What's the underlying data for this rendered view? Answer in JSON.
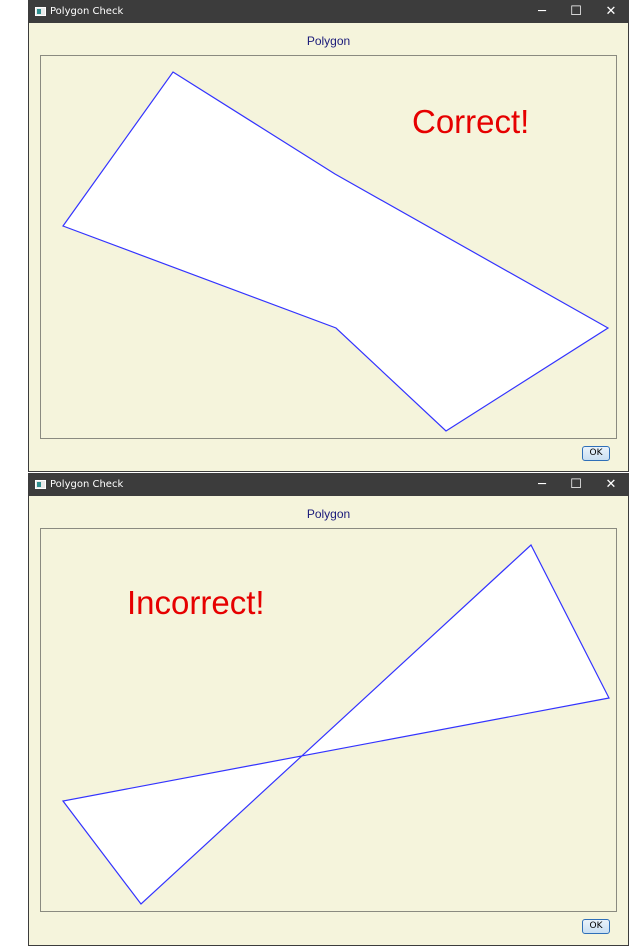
{
  "windows": [
    {
      "title": "Polygon Check",
      "controls": {
        "minimize": "─",
        "maximize": "☐",
        "close": "✕"
      },
      "panel_title": "Polygon",
      "verdict": "Correct!",
      "ok_label": "OK",
      "polygon_color": "#3333ff",
      "polygon_fill": "#ffffff",
      "verdict_color": "#e60000"
    },
    {
      "title": "Polygon Check",
      "controls": {
        "minimize": "─",
        "maximize": "☐",
        "close": "✕"
      },
      "panel_title": "Polygon",
      "verdict": "Incorrect!",
      "ok_label": "OK",
      "polygon_color": "#3333ff",
      "polygon_fill": "#ffffff",
      "verdict_color": "#e60000"
    }
  ],
  "icons": [
    "app-icon",
    "minimize-icon",
    "maximize-icon",
    "close-icon"
  ]
}
